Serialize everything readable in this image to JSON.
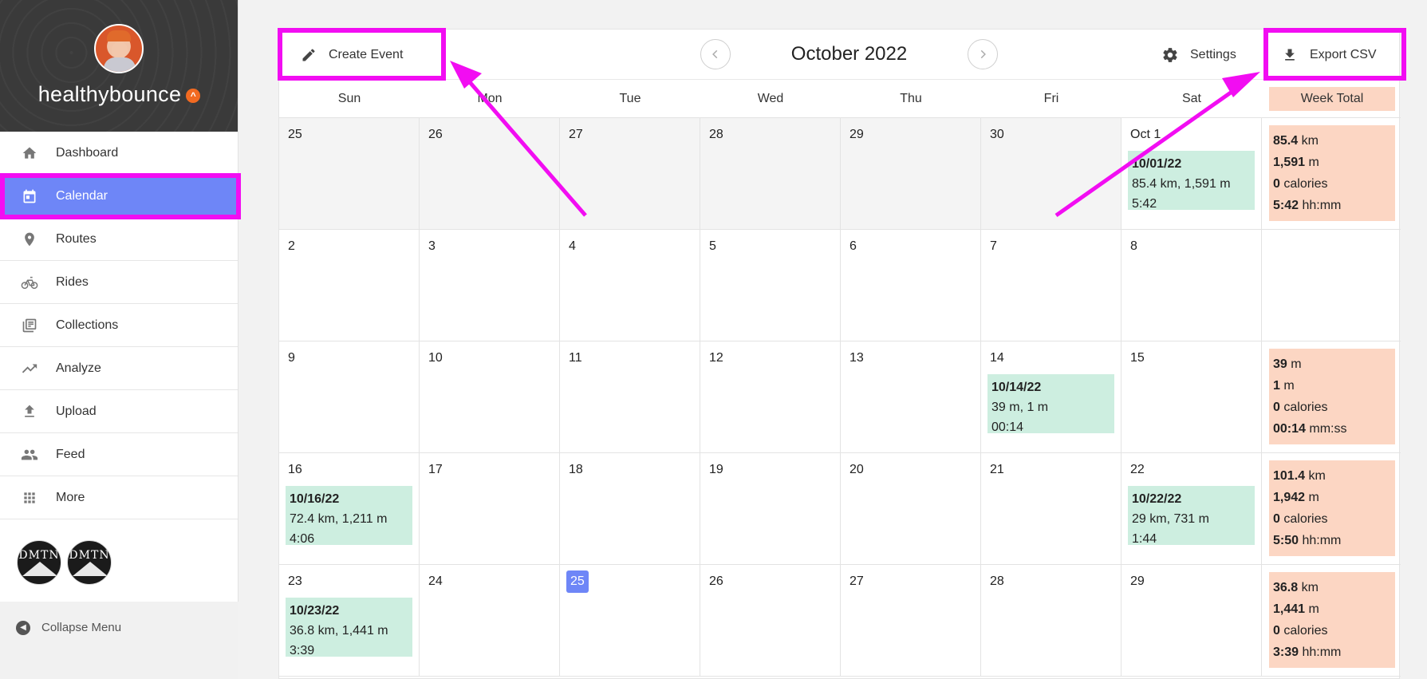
{
  "profile": {
    "username": "healthybounce",
    "rank_badge": "^"
  },
  "sidebar": {
    "items": [
      {
        "label": "Dashboard",
        "icon": "home-icon"
      },
      {
        "label": "Calendar",
        "icon": "calendar-icon"
      },
      {
        "label": "Routes",
        "icon": "location-pin-icon"
      },
      {
        "label": "Rides",
        "icon": "bicycle-icon"
      },
      {
        "label": "Collections",
        "icon": "collections-icon"
      },
      {
        "label": "Analyze",
        "icon": "trend-icon"
      },
      {
        "label": "Upload",
        "icon": "upload-icon"
      },
      {
        "label": "Feed",
        "icon": "people-icon"
      },
      {
        "label": "More",
        "icon": "grid-icon"
      }
    ],
    "clubs": [
      {
        "text": "DMTN"
      },
      {
        "text": "DMTN"
      }
    ],
    "collapse_label": "Collapse Menu"
  },
  "toolbar": {
    "create_event": "Create Event",
    "month_title": "October 2022",
    "settings": "Settings",
    "export_csv": "Export CSV"
  },
  "calendar": {
    "weekdays": [
      "Sun",
      "Mon",
      "Tue",
      "Wed",
      "Thu",
      "Fri",
      "Sat"
    ],
    "week_total_label": "Week Total",
    "weeks": [
      {
        "days": [
          "25",
          "26",
          "27",
          "28",
          "29",
          "30",
          "Oct 1"
        ],
        "events": [
          {
            "col": 6,
            "date": "10/01/22",
            "line1": "85.4 km, 1,591 m",
            "line2": "5:42"
          }
        ],
        "total": [
          {
            "v": "85.4",
            "u": "km"
          },
          {
            "v": "1,591",
            "u": "m"
          },
          {
            "v": "0",
            "u": "calories"
          },
          {
            "v": "5:42",
            "u": "hh:mm"
          }
        ]
      },
      {
        "days": [
          "2",
          "3",
          "4",
          "5",
          "6",
          "7",
          "8"
        ],
        "events": [],
        "total": []
      },
      {
        "days": [
          "9",
          "10",
          "11",
          "12",
          "13",
          "14",
          "15"
        ],
        "events": [
          {
            "col": 5,
            "date": "10/14/22",
            "line1": "39 m, 1 m",
            "line2": "00:14"
          }
        ],
        "total": [
          {
            "v": "39",
            "u": "m"
          },
          {
            "v": "1",
            "u": "m"
          },
          {
            "v": "0",
            "u": "calories"
          },
          {
            "v": "00:14",
            "u": "mm:ss"
          }
        ]
      },
      {
        "days": [
          "16",
          "17",
          "18",
          "19",
          "20",
          "21",
          "22"
        ],
        "events": [
          {
            "col": 0,
            "date": "10/16/22",
            "line1": "72.4 km, 1,211 m",
            "line2": "4:06"
          },
          {
            "col": 6,
            "date": "10/22/22",
            "line1": "29 km, 731 m",
            "line2": "1:44"
          }
        ],
        "total": [
          {
            "v": "101.4",
            "u": "km"
          },
          {
            "v": "1,942",
            "u": "m"
          },
          {
            "v": "0",
            "u": "calories"
          },
          {
            "v": "5:50",
            "u": "hh:mm"
          }
        ]
      },
      {
        "days": [
          "23",
          "24",
          "25",
          "26",
          "27",
          "28",
          "29"
        ],
        "today_col": 2,
        "events": [
          {
            "col": 0,
            "date": "10/23/22",
            "line1": "36.8 km, 1,441 m",
            "line2": "3:39"
          }
        ],
        "total": [
          {
            "v": "36.8",
            "u": "km"
          },
          {
            "v": "1,441",
            "u": "m"
          },
          {
            "v": "0",
            "u": "calories"
          },
          {
            "v": "3:39",
            "u": "hh:mm"
          }
        ]
      }
    ]
  },
  "colors": {
    "accent": "#6e86f7",
    "event_bg": "#cdeee0",
    "total_bg": "#fcd6c3",
    "annotation": "#f20df2"
  }
}
